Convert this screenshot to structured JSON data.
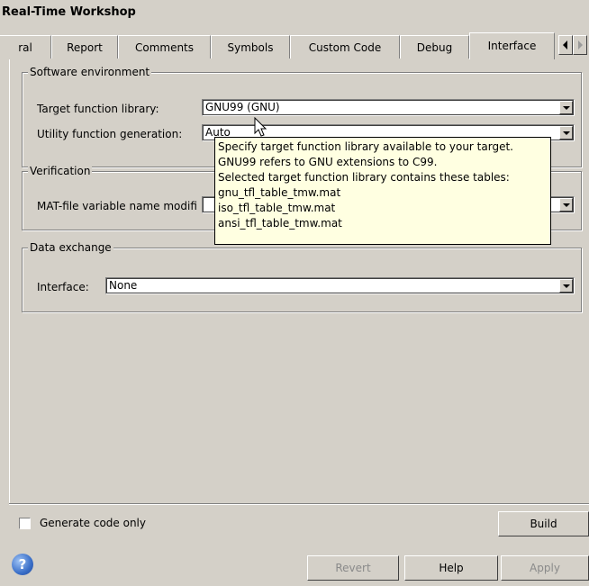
{
  "window": {
    "title": "Real-Time Workshop"
  },
  "tabs": [
    {
      "label": "ral"
    },
    {
      "label": "Report"
    },
    {
      "label": "Comments"
    },
    {
      "label": "Symbols"
    },
    {
      "label": "Custom Code"
    },
    {
      "label": "Debug"
    },
    {
      "label": "Interface"
    }
  ],
  "active_tab": "Interface",
  "software_env": {
    "legend": "Software environment",
    "tfl_label": "Target function library:",
    "tfl_value": "GNU99 (GNU)",
    "util_label": "Utility function generation:",
    "util_value": "Auto"
  },
  "verification": {
    "legend": "Verification",
    "mat_label": "MAT-file variable name modifi"
  },
  "data_exchange": {
    "legend": "Data exchange",
    "interface_label": "Interface:",
    "interface_value": "None"
  },
  "tooltip": {
    "lines": [
      "Specify target function library available to your target.",
      "GNU99 refers to GNU extensions to C99.",
      "Selected target function library contains these tables:",
      "gnu_tfl_table_tmw.mat",
      "iso_tfl_table_tmw.mat",
      "ansi_tfl_table_tmw.mat"
    ]
  },
  "footer": {
    "generate_code_only": "Generate code only",
    "generate_code_only_checked": false,
    "build": "Build",
    "revert": "Revert",
    "help": "Help",
    "apply": "Apply",
    "help_icon_glyph": "?"
  }
}
